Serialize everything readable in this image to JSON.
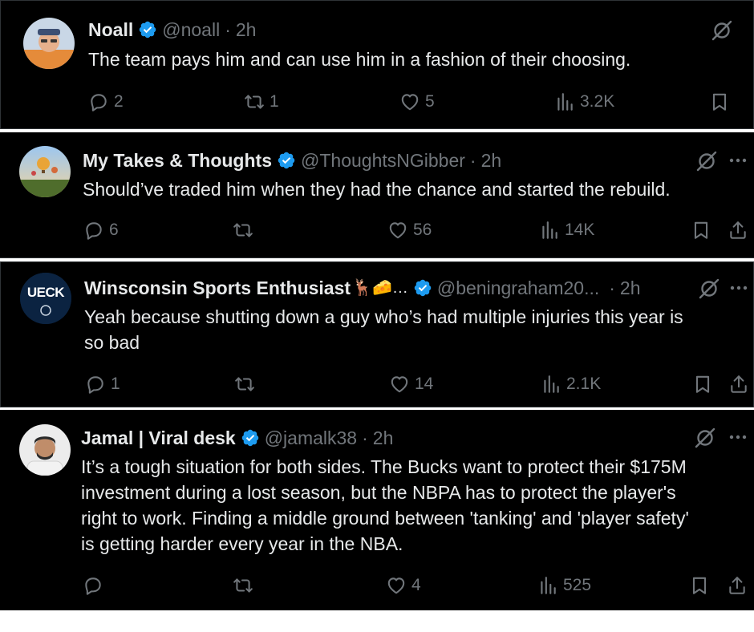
{
  "colors": {
    "background": "#000000",
    "text": "#e7e9ea",
    "muted": "#71767b",
    "verified": "#1d9bf0",
    "divider": "#2f3336"
  },
  "posts": [
    {
      "name": "Noall",
      "handle": "@noall",
      "separator": "·",
      "time": "2h",
      "text": "The team pays him and can use him in a fashion of their choosing.",
      "replies": "2",
      "reposts": "1",
      "likes": "5",
      "views": "3.2K"
    },
    {
      "name": "My Takes & Thoughts",
      "handle": "@ThoughtsNGibber",
      "separator": "·",
      "time": "2h",
      "text": "Should’ve traded him when they had the chance and started the rebuild.",
      "replies": "6",
      "reposts": "",
      "likes": "56",
      "views": "14K"
    },
    {
      "name": "Winsconsin Sports Enthusiast",
      "name_emoji": "🦌🧀…",
      "avatar_text": "UECK",
      "handle": "@beningraham20...",
      "separator": "·",
      "time": "2h",
      "text": "Yeah because shutting down a guy who’s had multiple injuries this year is\nso bad",
      "replies": "1",
      "reposts": "",
      "likes": "14",
      "views": "2.1K"
    },
    {
      "name": "Jamal | Viral desk",
      "handle": "@jamalk38",
      "separator": "·",
      "time": "2h",
      "text": "It’s a tough situation for both sides. The Bucks want to protect their $175M\ninvestment during a lost season, but the NBPA has to protect the player's\nright to work. Finding a middle ground between 'tanking' and 'player safety'\nis getting harder every year in the NBA.",
      "replies": "",
      "reposts": "",
      "likes": "4",
      "views": "525"
    }
  ],
  "icons": {
    "verified": "verified-badge-icon",
    "grok": "grok-icon",
    "more": "more-options-icon",
    "reply": "reply-icon",
    "repost": "repost-icon",
    "like": "like-icon",
    "views": "views-icon",
    "bookmark": "bookmark-icon",
    "share": "share-icon"
  }
}
